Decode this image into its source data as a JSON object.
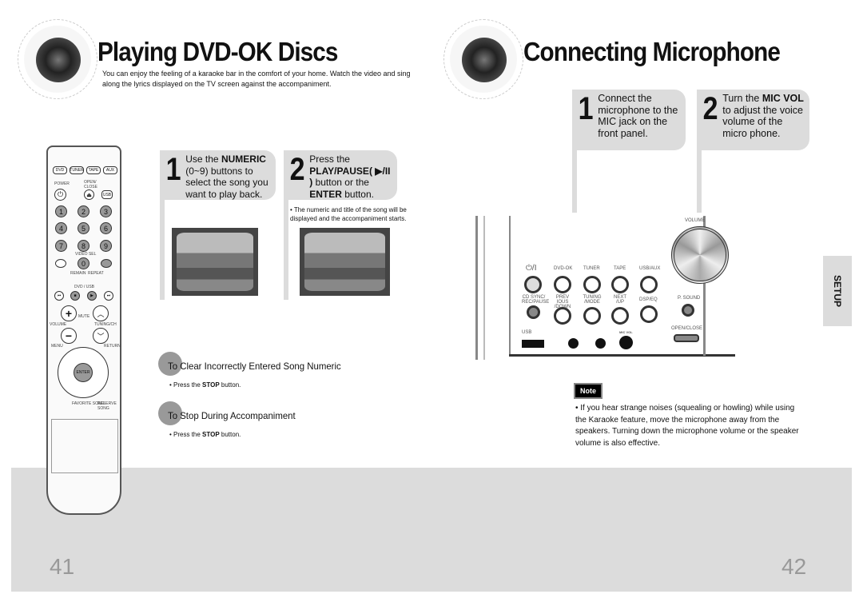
{
  "left_page": {
    "title": "Playing DVD-OK Discs",
    "intro": "You can enjoy the feeling of a karaoke bar in the comfort of your home. Watch the video and sing along the lyrics displayed on the TV screen against the accompaniment.",
    "steps": [
      {
        "num": "1",
        "pre": "Use the ",
        "bold": "NUMERIC",
        "post": " (0~9) buttons to select the song you want to play back."
      },
      {
        "num": "2",
        "pre": "Press the ",
        "bold": "PLAY/PAUSE( ▶/II )",
        "mid": " button or the ",
        "bold2": "ENTER",
        "post": " button.",
        "note": "• The numeric and title of the song will be displayed and the accompaniment starts."
      }
    ],
    "sections": [
      {
        "heading": "To Clear Incorrectly Entered Song Numeric",
        "bullet_pre": "• Press the ",
        "bullet_bold": "STOP",
        "bullet_post": " button."
      },
      {
        "heading": "To Stop During Accompaniment",
        "bullet_pre": "• Press the ",
        "bullet_bold": "STOP",
        "bullet_post": " button."
      }
    ],
    "page_number": "41",
    "remote": {
      "sources": [
        "DVD",
        "TUNER",
        "TAPE",
        "AUX"
      ],
      "power": "POWER",
      "open_close": "OPEN/ CLOSE",
      "usb": "USB",
      "digits": [
        "1",
        "2",
        "3",
        "4",
        "5",
        "6",
        "7",
        "8",
        "9",
        "0"
      ],
      "video_sel": "VIDEO SEL",
      "reset": "REMAIN",
      "rep": "REPEAT",
      "dvd_usb": "DVD / USB",
      "mute": "MUTE",
      "volume": "VOLUME",
      "tuning": "TUNING/CH",
      "menu": "MENU",
      "return": "RETURN",
      "enter": "ENTER",
      "favorite": "FAVORITE SONG",
      "reserve": "RESERVE SONG"
    }
  },
  "right_page": {
    "title": "Connecting Microphone",
    "steps": [
      {
        "num": "1",
        "pre": "Connect the microphone to the MIC jack on the front panel.",
        "bold": "",
        "post": ""
      },
      {
        "num": "2",
        "pre": "Turn the ",
        "bold": "MIC VOL",
        "post": " to adjust the voice volume of the micro phone."
      }
    ],
    "panel": {
      "volume": "VOLUME",
      "power": "⏻/I",
      "buttons": [
        "DVD-OK",
        "TUNER",
        "TAPE",
        "USB/AUX"
      ],
      "row2": [
        "CD SYNC/ REC/PAUSE",
        "PREV IOUS /DOWN",
        "TUNING /MODE",
        "NEXT /UP",
        "DSP/EQ"
      ],
      "psound": "P. SOUND",
      "usb": "USB",
      "mic_vol": "MIC VOL",
      "open_close": "OPEN/CLOSE"
    },
    "note_label": "Note",
    "note": "• If you hear strange noises (squealing or howling) while using the Karaoke feature, move the microphone away from the speakers. Turning down the microphone volume or the speaker volume is also effective.",
    "tab": "SETUP",
    "page_number": "42"
  }
}
